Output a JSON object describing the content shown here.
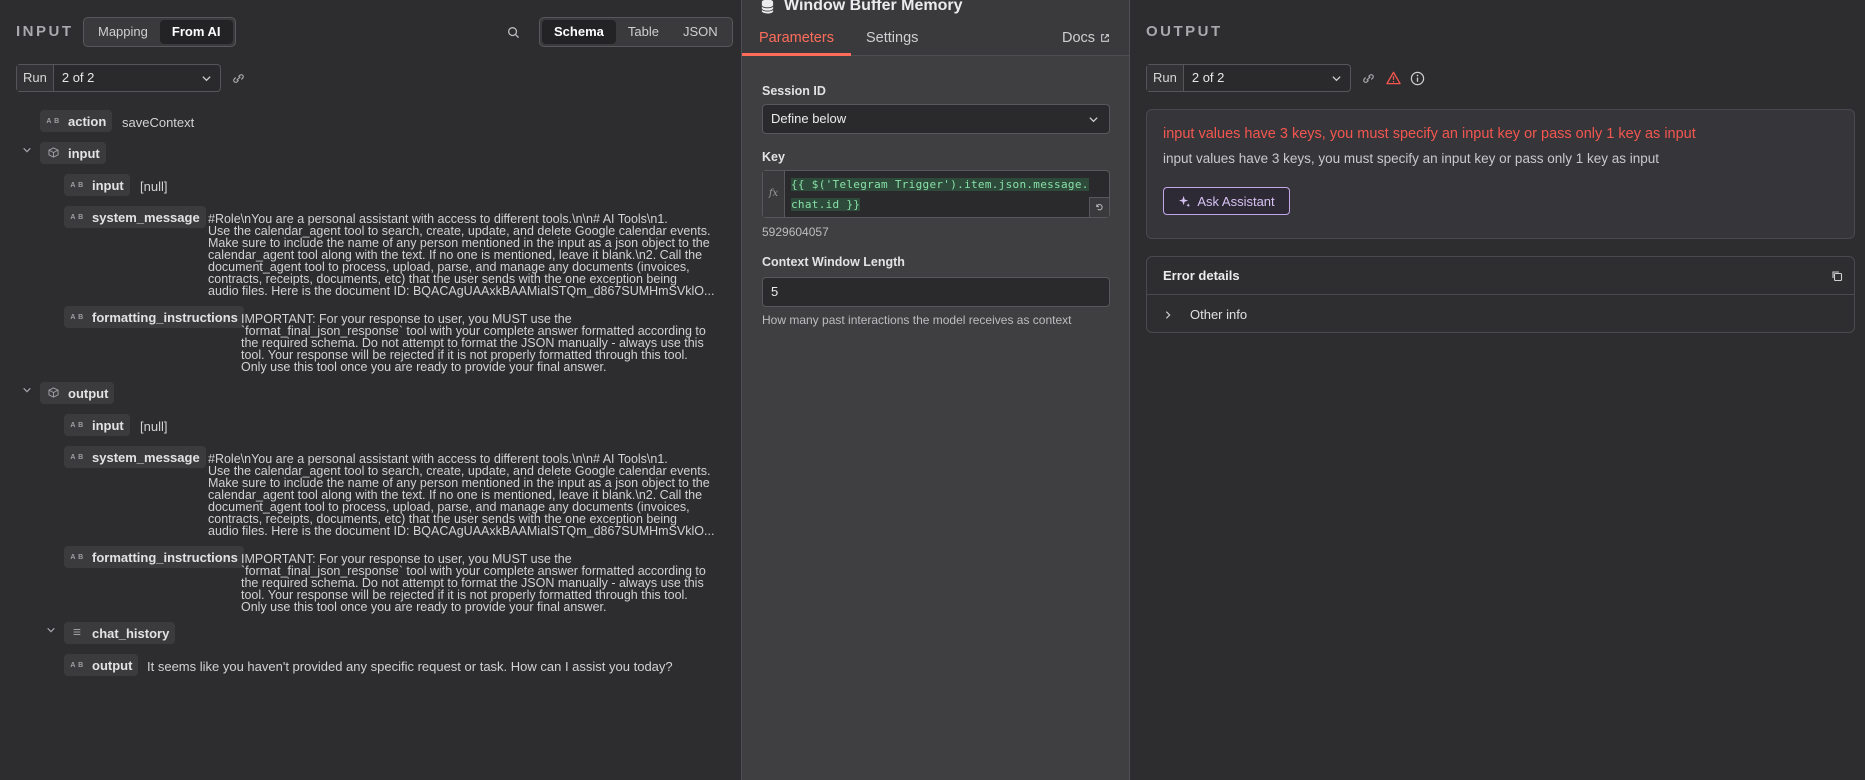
{
  "input_panel": {
    "title": "INPUT",
    "mode_toggle": [
      "Mapping",
      "From AI"
    ],
    "view_toggle": [
      "Schema",
      "Table",
      "JSON"
    ],
    "run_label": "Run",
    "run_value": "2 of 2",
    "tree": {
      "action": {
        "key": "action",
        "value": "saveContext"
      },
      "input_group": {
        "key": "input",
        "input": {
          "key": "input",
          "value": "[null]"
        },
        "system_message": {
          "key": "system_message"
        },
        "formatting_instructions": {
          "key": "formatting_instructions"
        }
      },
      "output_group": {
        "key": "output",
        "input": {
          "key": "input",
          "value": "[null]"
        },
        "system_message": {
          "key": "system_message"
        },
        "formatting_instructions": {
          "key": "formatting_instructions"
        },
        "chat_history": {
          "key": "chat_history"
        },
        "output": {
          "key": "output",
          "value": "It seems like you haven't provided any specific request or task. How can I assist you today?"
        }
      },
      "system_message_lines": [
        "#Role\\nYou are a personal assistant with access to different tools.\\n\\n# AI Tools\\n1.",
        "Use the calendar_agent tool to search, create, update, and delete Google calendar events.",
        "Make sure to include the name of any person mentioned in the input as a json object to the",
        "calendar_agent tool along with the text. If no one is mentioned, leave it blank.\\n2. Call the",
        "document_agent tool to process, upload, parse, and manage any documents (invoices,",
        "contracts, receipts, documents, etc) that the user sends with the one exception being",
        "audio files. Here is the document ID: BQACAgUAAxkBAAMiaISTQm_d867SUMHmSVklO..."
      ],
      "formatting_lines": [
        "IMPORTANT: For your response to user, you MUST use the",
        "`format_final_json_response` tool with your complete answer formatted according to",
        "the required schema. Do not attempt to format the JSON manually - always use this",
        "tool. Your response will be rejected if it is not properly formatted through this tool.",
        "Only use this tool once you are ready to provide your final answer."
      ],
      "type_badge": "A B"
    }
  },
  "node": {
    "title": "Window Buffer Memory",
    "tabs": [
      "Parameters",
      "Settings"
    ],
    "docs_label": "Docs",
    "session_id_label": "Session ID",
    "session_id_value": "Define below",
    "key_label": "Key",
    "key_expression_line1": "{{ $('Telegram Trigger').item.json.message.",
    "key_expression_line2": "chat.id }}",
    "key_resolved": "5929604057",
    "context_label": "Context Window Length",
    "context_value": "5",
    "context_hint": "How many past interactions the model receives as context",
    "fx_label": "fx"
  },
  "output_panel": {
    "title": "OUTPUT",
    "run_label": "Run",
    "run_value": "2 of 2",
    "error_title": "input values have 3 keys, you must specify an input key or pass only 1 key as input",
    "error_description": "input values have 3 keys, you must specify an input key or pass only 1 key as input",
    "ask_assistant_label": "Ask Assistant",
    "error_details_label": "Error details",
    "other_info_label": "Other info"
  },
  "colors": {
    "accent": "#ff6d5a",
    "error": "#f4564f",
    "assistant": "#c4a7e8",
    "expression": "#88e0a8"
  }
}
